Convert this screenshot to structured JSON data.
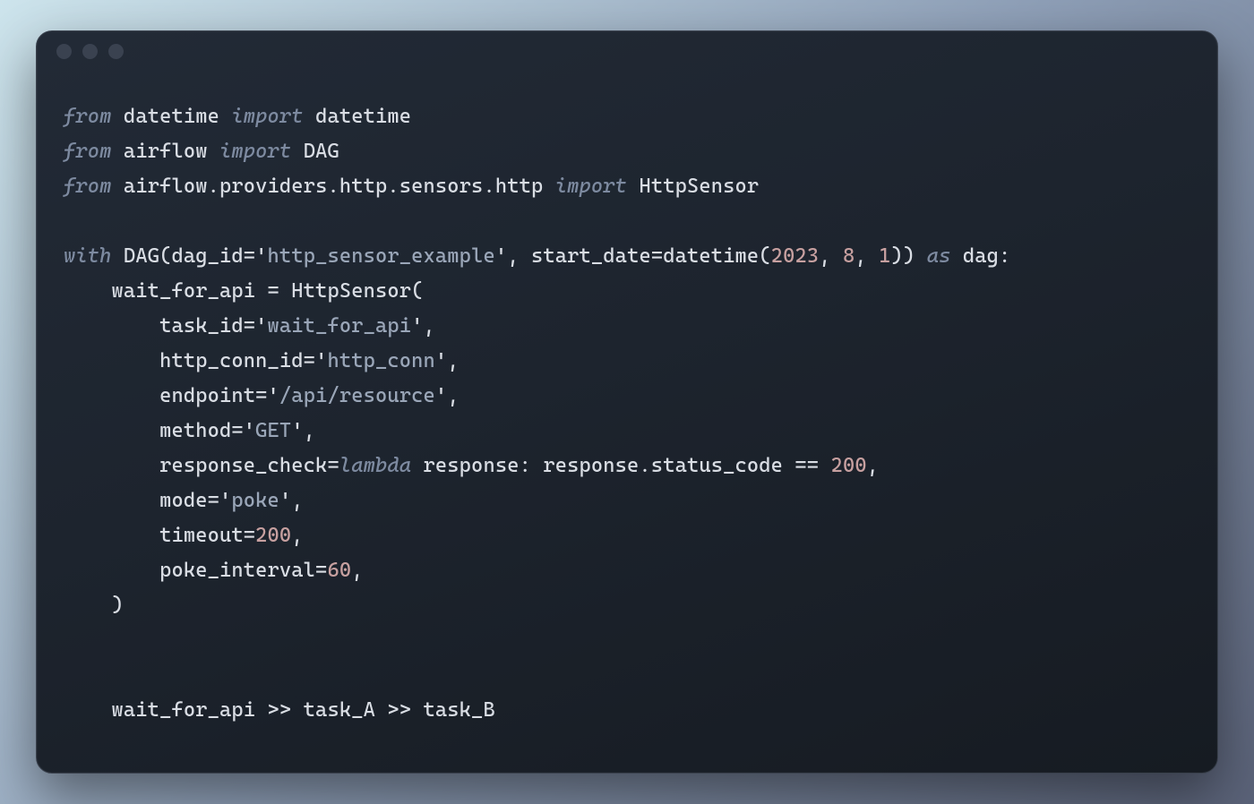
{
  "code": {
    "tokens": [
      [
        [
          "kw",
          "from"
        ],
        [
          "def",
          " datetime "
        ],
        [
          "kw",
          "import"
        ],
        [
          "def",
          " datetime"
        ]
      ],
      [
        [
          "kw",
          "from"
        ],
        [
          "def",
          " airflow "
        ],
        [
          "kw",
          "import"
        ],
        [
          "def",
          " DAG"
        ]
      ],
      [
        [
          "kw",
          "from"
        ],
        [
          "def",
          " airflow.providers.http.sensors.http "
        ],
        [
          "kw",
          "import"
        ],
        [
          "def",
          " HttpSensor"
        ]
      ],
      [],
      [
        [
          "kw",
          "with"
        ],
        [
          "def",
          " DAG(dag_id="
        ],
        [
          "q",
          "'"
        ],
        [
          "str",
          "http_sensor_example"
        ],
        [
          "q",
          "'"
        ],
        [
          "def",
          ", start_date=datetime("
        ],
        [
          "num",
          "2023"
        ],
        [
          "def",
          ", "
        ],
        [
          "num",
          "8"
        ],
        [
          "def",
          ", "
        ],
        [
          "num",
          "1"
        ],
        [
          "def",
          ")) "
        ],
        [
          "kw",
          "as"
        ],
        [
          "def",
          " dag:"
        ]
      ],
      [
        [
          "def",
          "    wait_for_api = HttpSensor("
        ]
      ],
      [
        [
          "def",
          "        task_id="
        ],
        [
          "q",
          "'"
        ],
        [
          "str",
          "wait_for_api"
        ],
        [
          "q",
          "'"
        ],
        [
          "def",
          ","
        ]
      ],
      [
        [
          "def",
          "        http_conn_id="
        ],
        [
          "q",
          "'"
        ],
        [
          "str",
          "http_conn"
        ],
        [
          "q",
          "'"
        ],
        [
          "def",
          ","
        ]
      ],
      [
        [
          "def",
          "        endpoint="
        ],
        [
          "q",
          "'"
        ],
        [
          "str",
          "/api/resource"
        ],
        [
          "q",
          "'"
        ],
        [
          "def",
          ","
        ]
      ],
      [
        [
          "def",
          "        method="
        ],
        [
          "q",
          "'"
        ],
        [
          "str",
          "GET"
        ],
        [
          "q",
          "'"
        ],
        [
          "def",
          ","
        ]
      ],
      [
        [
          "def",
          "        response_check="
        ],
        [
          "kw",
          "lambda"
        ],
        [
          "def",
          " response: response.status_code == "
        ],
        [
          "num",
          "200"
        ],
        [
          "def",
          ","
        ]
      ],
      [
        [
          "def",
          "        mode="
        ],
        [
          "q",
          "'"
        ],
        [
          "str",
          "poke"
        ],
        [
          "q",
          "'"
        ],
        [
          "def",
          ","
        ]
      ],
      [
        [
          "def",
          "        timeout="
        ],
        [
          "num",
          "200"
        ],
        [
          "def",
          ","
        ]
      ],
      [
        [
          "def",
          "        poke_interval="
        ],
        [
          "num",
          "60"
        ],
        [
          "def",
          ","
        ]
      ],
      [
        [
          "def",
          "    )"
        ]
      ],
      [],
      [],
      [
        [
          "def",
          "    wait_for_api >> task_A >> task_B"
        ]
      ]
    ]
  }
}
